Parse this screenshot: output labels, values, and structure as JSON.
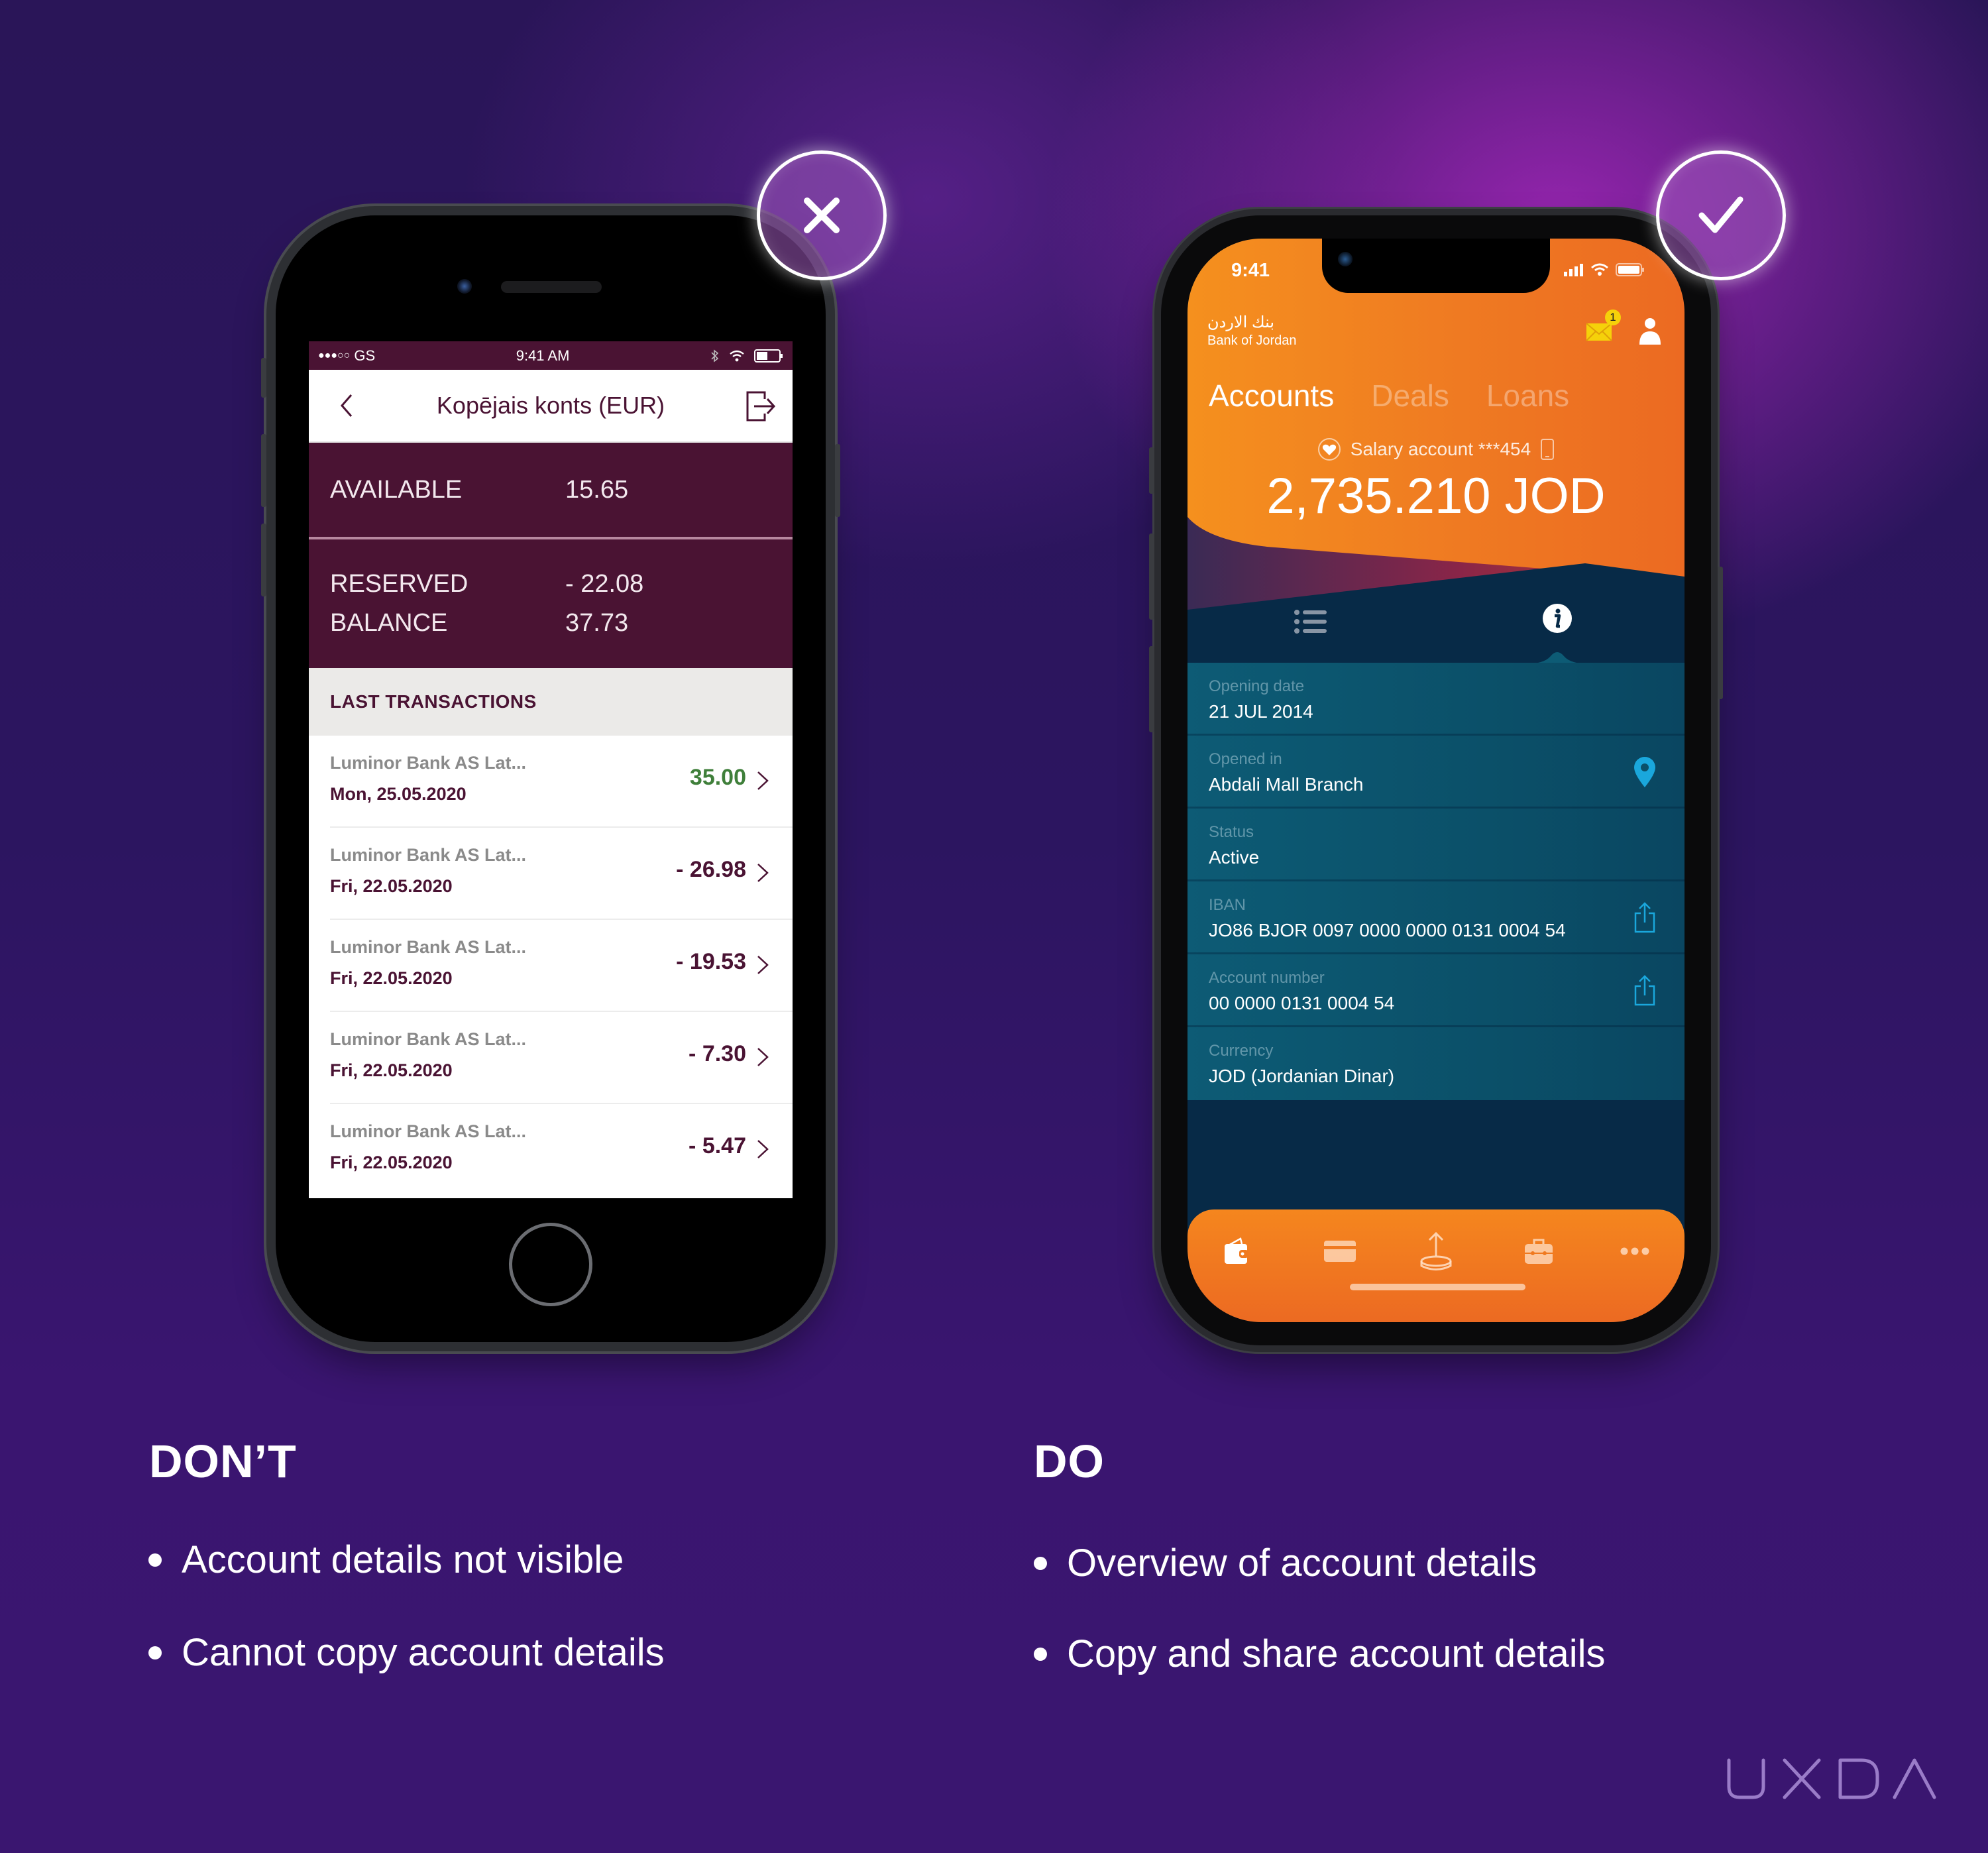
{
  "dont_panel": {
    "badge_icon": "x-mark-icon",
    "heading": "DON’T",
    "bullets": [
      "Account details not visible",
      "Cannot copy account details"
    ],
    "phone": {
      "status_bar": {
        "carrier": "GS",
        "signal_dots": "●●●○○",
        "time": "9:41 AM"
      },
      "header": {
        "title": "Kopējais konts (EUR)",
        "back_icon": "chevron-left-icon",
        "action_icon": "logout-icon"
      },
      "available": {
        "label": "AVAILABLE",
        "value": "15.65"
      },
      "reserved": {
        "label": "RESERVED",
        "value": "- 22.08"
      },
      "balance": {
        "label": "BALANCE",
        "value": "37.73"
      },
      "transactions_header": "LAST TRANSACTIONS",
      "transactions": [
        {
          "merchant": "Luminor Bank AS Lat...",
          "date": "Mon, 25.05.2020",
          "amount": "35.00",
          "positive": true
        },
        {
          "merchant": "Luminor Bank AS Lat...",
          "date": "Fri, 22.05.2020",
          "amount": "- 26.98",
          "positive": false
        },
        {
          "merchant": "Luminor Bank AS Lat...",
          "date": "Fri, 22.05.2020",
          "amount": "- 19.53",
          "positive": false
        },
        {
          "merchant": "Luminor Bank AS Lat...",
          "date": "Fri, 22.05.2020",
          "amount": "- 7.30",
          "positive": false
        },
        {
          "merchant": "Luminor Bank AS Lat...",
          "date": "Fri, 22.05.2020",
          "amount": "- 5.47",
          "positive": false
        }
      ],
      "colors": {
        "brand": "#4a1333",
        "positive": "#3f7f3a"
      }
    }
  },
  "do_panel": {
    "badge_icon": "checkmark-icon",
    "heading": "DO",
    "bullets": [
      "Overview of account details",
      "Copy and share account details"
    ],
    "phone": {
      "status_bar": {
        "time": "9:41"
      },
      "logo": {
        "arabic": "بنك الاردن",
        "english": "Bank of Jordan"
      },
      "mail_badge_count": "1",
      "tabs": [
        {
          "label": "Accounts",
          "active": true
        },
        {
          "label": "Deals",
          "active": false
        },
        {
          "label": "Loans",
          "active": false
        }
      ],
      "account_name": "Salary account ***454",
      "balance": "2,735.210 JOD",
      "segments": [
        {
          "icon": "list-icon",
          "active": false
        },
        {
          "icon": "info-icon",
          "active": true
        }
      ],
      "details": [
        {
          "label": "Opening date",
          "value": "21 JUL 2014",
          "action": null
        },
        {
          "label": "Opened in",
          "value": "Abdali Mall Branch",
          "action": "location-pin-icon"
        },
        {
          "label": "Status",
          "value": "Active",
          "action": null
        },
        {
          "label": "IBAN",
          "value": "JO86 BJOR 0097 0000 0000 0131 0004 54",
          "action": "share-icon"
        },
        {
          "label": "Account number",
          "value": "00 0000 0131 0004 54",
          "action": "share-icon"
        },
        {
          "label": "Currency",
          "value": "JOD (Jordanian Dinar)",
          "action": null
        }
      ],
      "tabbar": [
        "wallet-icon",
        "card-icon",
        "transfer-icon",
        "briefcase-icon",
        "more-icon"
      ],
      "colors": {
        "orange": "#f08020",
        "navy": "#072a47",
        "teal": "#0d5b75",
        "accent_blue": "#1aa7dc"
      }
    }
  },
  "brand_logo": "UXDA"
}
